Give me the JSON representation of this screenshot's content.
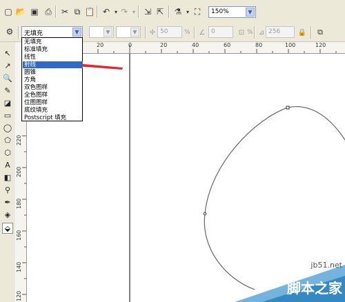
{
  "toolbar": {
    "zoom_value": "150%"
  },
  "property_bar": {
    "fill_type_value": "无填充",
    "angle_value": "50",
    "angle_unit": "%",
    "edge_pad_value": "0",
    "steps_value": "256",
    "percent_unit": "%"
  },
  "fill_dropdown": {
    "options": [
      "无填充",
      "标准填充",
      "线性",
      "射线",
      "圆锥",
      "方角",
      "双色图样",
      "全色图样",
      "位图图样",
      "底纹填充",
      "Postscript 填充"
    ],
    "selected_index": 3
  },
  "rulers": {
    "horizontal_labels": [
      "20",
      "0",
      "20",
      "40",
      "60",
      "80",
      "100",
      "120"
    ],
    "vertical_labels": [
      "220",
      "200",
      "180",
      "160",
      "140",
      "120"
    ]
  },
  "watermark": {
    "site": "jb51.net",
    "brand": "脚本之家"
  },
  "colors": {
    "selection": "#316ac5",
    "arrow": "#e8222a",
    "toolbar_bg": "#ece9d8"
  }
}
